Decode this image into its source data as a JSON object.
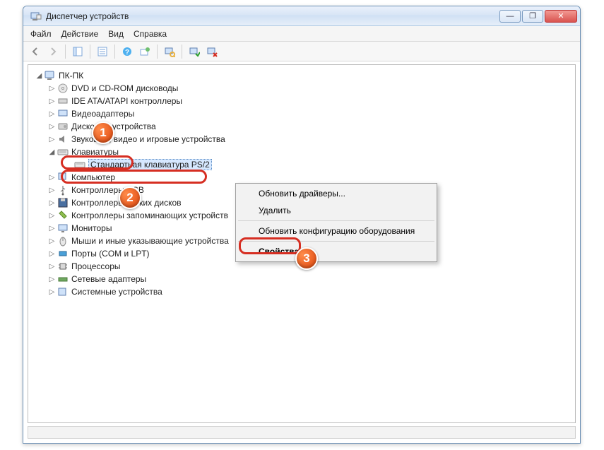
{
  "window": {
    "title": "Диспетчер устройств"
  },
  "controls": {
    "min": "—",
    "max": "❐",
    "close": "✕"
  },
  "menu": [
    "Файл",
    "Действие",
    "Вид",
    "Справка"
  ],
  "tree": {
    "root": "ПК-ПК",
    "items": [
      {
        "label": "DVD и CD-ROM дисководы"
      },
      {
        "label": "IDE ATA/ATAPI контроллеры"
      },
      {
        "label": "Видеоадаптеры"
      },
      {
        "label": "Дисковые устройства"
      },
      {
        "label": "Звуковые, видео и игровые устройства"
      },
      {
        "label": "Клавиатуры",
        "expanded": true
      },
      {
        "label": "Стандартная клавиатура PS/2",
        "child": true,
        "selected": true
      },
      {
        "label": "Компьютер"
      },
      {
        "label": "Контроллеры USB"
      },
      {
        "label": "Контроллеры гибких дисков"
      },
      {
        "label": "Контроллеры запоминающих устройств"
      },
      {
        "label": "Мониторы"
      },
      {
        "label": "Мыши и иные указывающие устройства"
      },
      {
        "label": "Порты (COM и LPT)"
      },
      {
        "label": "Процессоры"
      },
      {
        "label": "Сетевые адаптеры"
      },
      {
        "label": "Системные устройства"
      }
    ]
  },
  "context": {
    "items": [
      "Обновить драйверы...",
      "Удалить",
      "Обновить конфигурацию оборудования",
      "Свойства"
    ]
  },
  "callouts": {
    "b1": "1",
    "b2": "2",
    "b3": "3"
  }
}
